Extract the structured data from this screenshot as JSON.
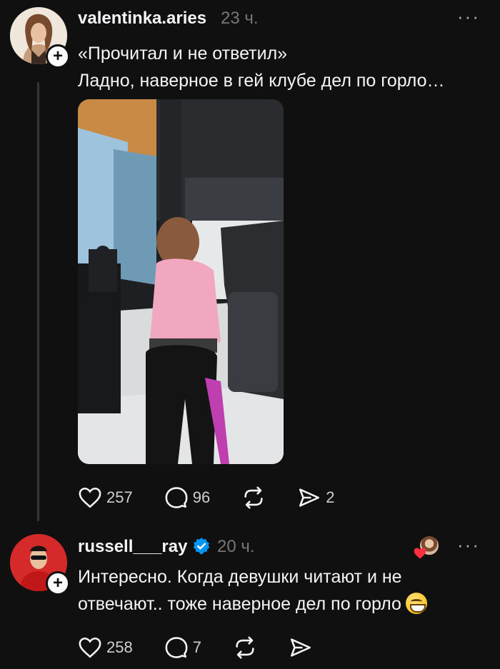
{
  "post": {
    "username": "valentinka.aries",
    "time": "23 ч.",
    "more_icon": "more-dots-icon",
    "text_line1": "«Прочитал и не ответил»",
    "text_line2": "Ладно, наверное в гей клубе дел по горло…",
    "media_alt": "gym-photo",
    "actions": {
      "likes": "257",
      "comments": "96",
      "reposts": "",
      "shares": "2"
    }
  },
  "reply": {
    "username": "russell___ray",
    "time": "20 ч.",
    "text_line1": "Интересно. Когда девушки читают и не",
    "text_line2": "отвечают.. тоже наверное дел по горло",
    "emoji": "grinning-face-emoji",
    "actions": {
      "likes": "258",
      "comments": "7",
      "reposts": "",
      "shares": ""
    }
  },
  "colors": {
    "background": "#101010",
    "text": "#f3f5f7",
    "muted": "#777777",
    "verified": "#0095f6",
    "heart": "#ff3040"
  }
}
